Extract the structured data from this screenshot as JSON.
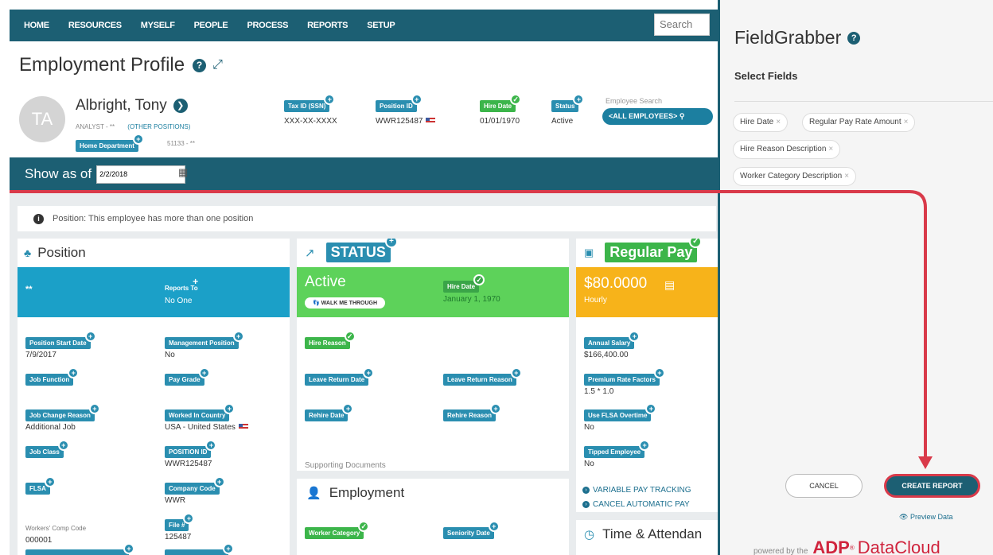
{
  "nav": {
    "items": [
      "HOME",
      "RESOURCES",
      "MYSELF",
      "PEOPLE",
      "PROCESS",
      "REPORTS",
      "SETUP"
    ],
    "search_placeholder": "Search"
  },
  "profile": {
    "title": "Employment Profile",
    "initials": "TA",
    "name": "Albright, Tony",
    "job": "ANALYST - **",
    "other_positions": "(OTHER POSITIONS)",
    "home_department_label": "Home Department",
    "home_department_value": "51133 - **",
    "fields": [
      {
        "label": "Tax ID (SSN)",
        "value": "XXX-XX-XXXX"
      },
      {
        "label": "Position ID",
        "value": "WWR125487"
      },
      {
        "label": "Hire Date",
        "value": "01/01/1970"
      },
      {
        "label": "Status",
        "value": "Active"
      }
    ],
    "employee_search_label": "Employee Search",
    "employee_search_value": "<ALL EMPLOYEES>"
  },
  "show_as_of": {
    "label": "Show as of",
    "date": "2/2/2018"
  },
  "info_message": "Position: This employee has more than one position",
  "position": {
    "title": "Position",
    "band_left": "**",
    "reports_to_label": "Reports To",
    "reports_to_value": "No One",
    "fields": [
      {
        "label": "Position Start Date",
        "value": "7/9/2017"
      },
      {
        "label": "Management Position",
        "value": "No"
      },
      {
        "label": "Job Function",
        "value": ""
      },
      {
        "label": "Pay Grade",
        "value": ""
      },
      {
        "label": "Job Change Reason",
        "value": "Additional Job"
      },
      {
        "label": "Worked In Country",
        "value": "USA - United States"
      },
      {
        "label": "Job Class",
        "value": ""
      },
      {
        "label": "POSITION ID",
        "value": "WWR125487"
      },
      {
        "label": "FLSA",
        "value": ""
      },
      {
        "label": "Company Code",
        "value": "WWR"
      },
      {
        "label": "Workers' Comp Code",
        "value": "000001"
      },
      {
        "label": "File #",
        "value": "125487"
      }
    ]
  },
  "status": {
    "title": "STATUS",
    "value": "Active",
    "walk_me": "WALK ME THROUGH",
    "hire_date_label": "Hire Date",
    "hire_date_value": "January 1, 1970",
    "fields": [
      "Hire Reason",
      "Leave Return Date",
      "Leave Return Reason",
      "Rehire Date",
      "Rehire Reason"
    ],
    "supporting_docs": "Supporting Documents"
  },
  "employment": {
    "title": "Employment",
    "fields": [
      "Worker Category",
      "Seniority Date"
    ]
  },
  "regular_pay": {
    "title": "Regular Pay",
    "amount": "$80.0000",
    "period": "Hourly",
    "fields": [
      {
        "label": "Annual Salary",
        "value": "$166,400.00"
      },
      {
        "label": "Premium Rate Factors",
        "value": "1.5 * 1.0"
      },
      {
        "label": "Use FLSA Overtime",
        "value": "No"
      },
      {
        "label": "Tipped Employee",
        "value": "No"
      }
    ],
    "links": [
      "VARIABLE PAY TRACKING",
      "CANCEL AUTOMATIC PAY"
    ]
  },
  "time_attendance": {
    "title": "Time & Attendan"
  },
  "fieldgrabber": {
    "title": "FieldGrabber",
    "select_fields": "Select Fields",
    "chips": [
      "Hire Date",
      "Regular Pay Rate Amount",
      "Hire Reason Description",
      "Worker Category Description"
    ],
    "cancel": "CANCEL",
    "create": "CREATE REPORT",
    "preview": "Preview Data",
    "powered_by": "powered by the",
    "adp": "ADP",
    "datacloud": "DataCloud"
  },
  "colors": {
    "brand": "#1c5f73",
    "tag": "#2a8eb0",
    "green": "#3cb54a",
    "pay": "#f7b31a",
    "arrow": "#d93a4a"
  }
}
